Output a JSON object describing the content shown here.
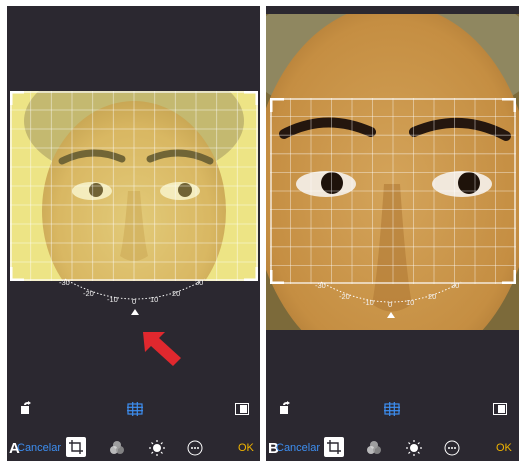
{
  "panels": [
    {
      "letter": "A",
      "cancel_label": "Cancelar",
      "ok_label": "OK",
      "dial_ticks": [
        "-30",
        "-20",
        "-10",
        "0",
        "10",
        "20",
        "30"
      ],
      "tilt_filter": true
    },
    {
      "letter": "B",
      "cancel_label": "Cancelar",
      "ok_label": "OK",
      "dial_ticks": [
        "-30",
        "-20",
        "-10",
        "0",
        "10",
        "20",
        "30"
      ],
      "tilt_filter": false
    }
  ],
  "colors": {
    "accent_blue": "#3d8ef0",
    "ok_yellow": "#f0b400",
    "arrow_red": "#e0282e",
    "panel_bg": "#2b2830"
  },
  "icons": {
    "rotate": "rotate-icon",
    "straighten": "straighten-grid-icon",
    "aspect": "aspect-ratio-icon",
    "crop": "crop-rotate-icon",
    "filters": "filters-icon",
    "adjust": "adjust-light-icon",
    "more": "more-icon",
    "pointer": "red-arrow-icon"
  }
}
